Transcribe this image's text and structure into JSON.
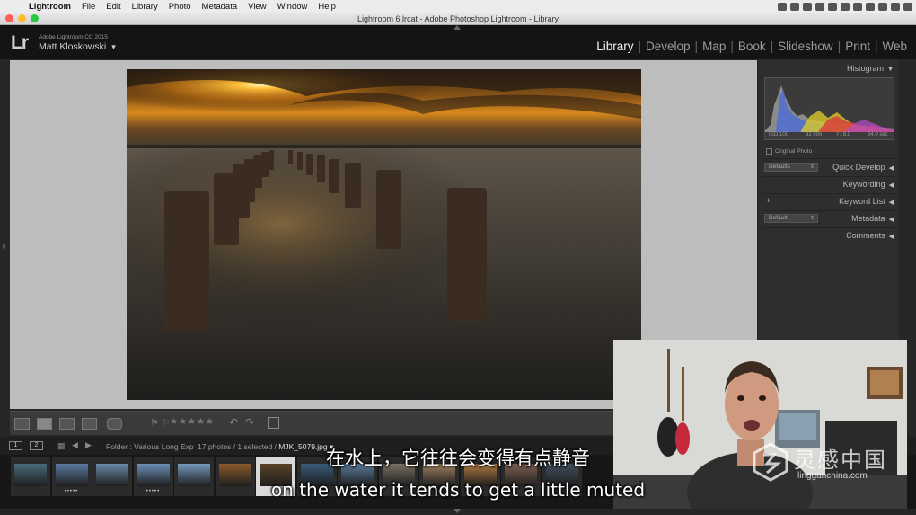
{
  "menubar": {
    "app_name": "Lightroom",
    "items": [
      "File",
      "Edit",
      "Library",
      "Photo",
      "Metadata",
      "View",
      "Window",
      "Help"
    ]
  },
  "window": {
    "title": "Lightroom 6.lrcat - Adobe Photoshop Lightroom - Library"
  },
  "identity": {
    "logo": "Lr",
    "product": "Adobe Lightroom CC 2015",
    "user": "Matt Kloskowski",
    "user_menu": "▾"
  },
  "modules": [
    "Library",
    "Develop",
    "Map",
    "Book",
    "Slideshow",
    "Print",
    "Web"
  ],
  "active_module": "Library",
  "right_panel": {
    "histogram": {
      "title": "Histogram",
      "iso": "ISO 100",
      "focal": "32 mm",
      "aperture": "f / 8.0",
      "shutter": "64.0 sec",
      "original_photo": "Original Photo"
    },
    "quick_develop": {
      "title": "Quick Develop",
      "preset": "Defaults"
    },
    "keywording": {
      "title": "Keywording"
    },
    "keyword_list": {
      "title": "Keyword List",
      "add": "+"
    },
    "metadata": {
      "title": "Metadata",
      "preset": "Default"
    },
    "comments": {
      "title": "Comments"
    }
  },
  "toolbar": {
    "flags": "⚑ ⚐",
    "stars": "★★★★★",
    "rotate_left": "↶",
    "rotate_right": "↷"
  },
  "filmstrip_bar": {
    "screen1": "1",
    "screen2": "2",
    "grid": "▦",
    "back": "◀",
    "forward": "▶",
    "folder": "Folder : Various Long Exp",
    "count": "17 photos / 1 selected /",
    "filename": "MJK_5079.jpg ▾"
  },
  "filmstrip": {
    "selected_index": 6,
    "thumbs": [
      {
        "dots": "",
        "tone": "#4a6a7a"
      },
      {
        "dots": "•••••",
        "tone": "#5a7aa0"
      },
      {
        "dots": "",
        "tone": "#6a88a8"
      },
      {
        "dots": "•••••",
        "tone": "#6b8fb5"
      },
      {
        "dots": "",
        "tone": "#7598bd"
      },
      {
        "dots": "",
        "tone": "#8a5a2a"
      },
      {
        "dots": "",
        "tone": "#5a4328"
      },
      {
        "dots": "",
        "tone": "#3a5a7a"
      },
      {
        "dots": "",
        "tone": "#5a7a9a"
      },
      {
        "dots": "",
        "tone": "#7a7060"
      },
      {
        "dots": "",
        "tone": "#a08060"
      },
      {
        "dots": "",
        "tone": "#b07a40"
      },
      {
        "dots": "",
        "tone": "#806050"
      },
      {
        "dots": "",
        "tone": "#405060"
      }
    ]
  },
  "subtitles": {
    "chinese": "在水上，它往往会变得有点静音",
    "english": "on the water it tends to get a little muted"
  },
  "watermark": {
    "title": "灵感中国",
    "url": "lingganchina.com"
  },
  "colors": {
    "accent_active": "#f2f2f2",
    "panel_bg": "#2e2e2e",
    "traffic_red": "#fd5f57",
    "traffic_yellow": "#febc2e",
    "traffic_green": "#28c840"
  }
}
